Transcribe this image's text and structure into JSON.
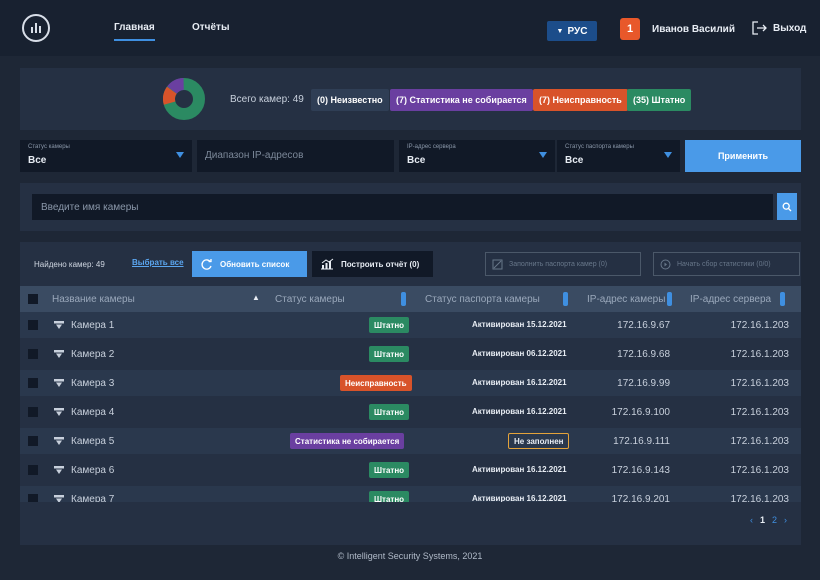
{
  "header": {
    "tabs": [
      {
        "label": "Главная",
        "active": true
      },
      {
        "label": "Отчёты",
        "active": false
      }
    ],
    "language": "РУС",
    "notifications_count": "1",
    "user_name": "Иванов Василий",
    "logout_label": "Выход"
  },
  "summary": {
    "total_label": "Всего камер: 49",
    "chips": [
      {
        "label": "(0) Неизвестно",
        "count": 0,
        "color": "#2f3e55"
      },
      {
        "label": "(7) Статистика не собирается",
        "count": 7,
        "color": "#6a3fa0"
      },
      {
        "label": "(7) Неисправность",
        "count": 7,
        "color": "#d8532a"
      },
      {
        "label": "(35) Штатно",
        "count": 35,
        "color": "#2b8a62"
      }
    ]
  },
  "filters": {
    "camera_status": {
      "label": "Статус камеры",
      "value": "Все"
    },
    "ip_range": {
      "placeholder": "Диапазон IP-адресов"
    },
    "server_ip": {
      "label": "IP-адрес сервера",
      "value": "Все"
    },
    "passport_status": {
      "label": "Статус паспорта камеры",
      "value": "Все"
    },
    "apply_label": "Применить"
  },
  "search": {
    "placeholder": "Введите имя камеры"
  },
  "toolbar": {
    "found_label": "Найдено камер: 49",
    "select_all": "Выбрать все",
    "refresh": "Обновить список",
    "build_report": "Построить отчёт (0)",
    "fill_passports": "Заполнить паспорта камер (0)",
    "start_stats": "Начать сбор статистики (0/0)"
  },
  "table": {
    "headers": {
      "name": "Название камеры",
      "status": "Статус камеры",
      "passport": "Статус паспорта камеры",
      "camera_ip": "IP-адрес камеры",
      "server_ip": "IP-адрес сервера"
    },
    "rows": [
      {
        "name": "Камера 1",
        "status": "Штатно",
        "status_type": "ok",
        "passport": "Активирован 15.12.2021",
        "camera_ip": "172.16.9.67",
        "server_ip": "172.16.1.203"
      },
      {
        "name": "Камера 2",
        "status": "Штатно",
        "status_type": "ok",
        "passport": "Активирован 06.12.2021",
        "camera_ip": "172.16.9.68",
        "server_ip": "172.16.1.203"
      },
      {
        "name": "Камера 3",
        "status": "Неисправность",
        "status_type": "fault",
        "passport": "Активирован 16.12.2021",
        "camera_ip": "172.16.9.99",
        "server_ip": "172.16.1.203"
      },
      {
        "name": "Камера 4",
        "status": "Штатно",
        "status_type": "ok",
        "passport": "Активирован 16.12.2021",
        "camera_ip": "172.16.9.100",
        "server_ip": "172.16.1.203"
      },
      {
        "name": "Камера 5",
        "status": "Статистика не собирается",
        "status_type": "nostats",
        "passport": "Не заполнен",
        "passport_empty": true,
        "camera_ip": "172.16.9.111",
        "server_ip": "172.16.1.203"
      },
      {
        "name": "Камера 6",
        "status": "Штатно",
        "status_type": "ok",
        "passport": "Активирован 16.12.2021",
        "camera_ip": "172.16.9.143",
        "server_ip": "172.16.1.203"
      },
      {
        "name": "Камера 7",
        "status": "Штатно",
        "status_type": "ok",
        "passport": "Активирован 16.12.2021",
        "camera_ip": "172.16.9.201",
        "server_ip": "172.16.1.203"
      }
    ]
  },
  "pagination": {
    "prev": "‹",
    "current": "1",
    "next_page": "2",
    "next": "›"
  },
  "footer": "© Intelligent Security Systems, 2021",
  "colors": {
    "ok": "#2b8a62",
    "fault": "#d8532a",
    "nostats": "#6a3fa0",
    "accent": "#4a9ae8"
  }
}
